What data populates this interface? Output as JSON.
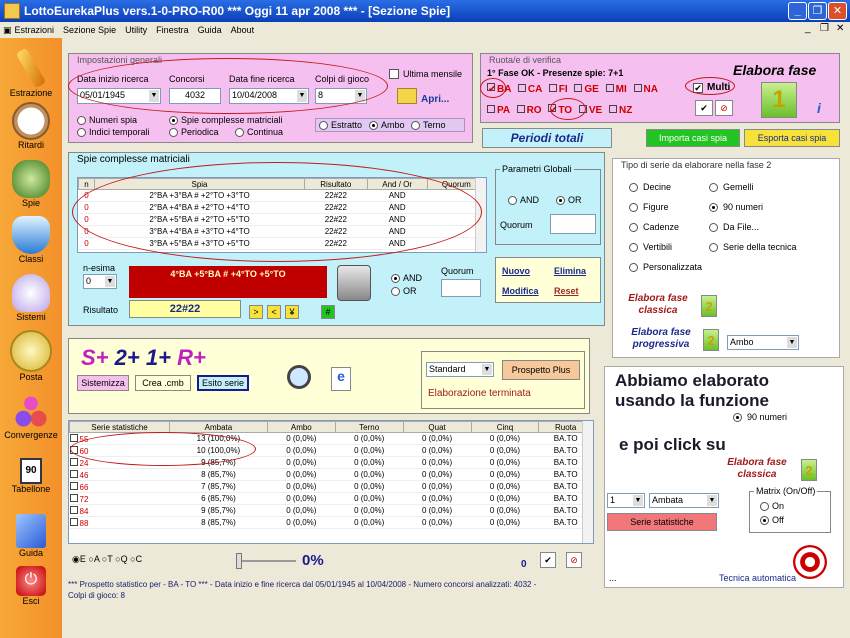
{
  "window": {
    "title": "LottoEurekaPlus vers.1-0-PRO-R00  ***  Oggi 11 apr 2008  ***   - [Sezione Spie]"
  },
  "menu": [
    "Estrazioni",
    "Sezione Spie",
    "Utility",
    "Finestra",
    "Guida",
    "About"
  ],
  "sidebar": [
    "Estrazione",
    "Ritardi",
    "Spie",
    "Classi",
    "Sistemi",
    "Posta",
    "Convergenze",
    "Tabellone",
    "Guida",
    "Esci"
  ],
  "tabellone_num": "90",
  "settings": {
    "title": "Impostazioni generali",
    "date_start_label": "Data inizio ricerca",
    "date_start": "05/01/1945",
    "concorsi_label": "Concorsi",
    "concorsi": "4032",
    "date_end_label": "Data fine ricerca",
    "date_end": "10/04/2008",
    "colpi_label": "Colpi di gioco",
    "colpi": "8",
    "ultima_label": "Ultima mensile",
    "apri_label": "Apri...",
    "numeri_spia": "Numeri spia",
    "spie_complesse": "Spie complesse matriciali",
    "indici": "Indici temporali",
    "periodica": "Periodica",
    "continua": "Continua",
    "estratto": "Estratto",
    "ambo": "Ambo",
    "terno": "Terno"
  },
  "ruota": {
    "title": "Ruota/e di verifica",
    "status": "1° Fase OK - Presenze spie: 7+1",
    "row1": [
      "BA",
      "CA",
      "FI",
      "GE",
      "MI",
      "NA"
    ],
    "row2": [
      "PA",
      "RO",
      "TO",
      "VE",
      "NZ"
    ],
    "multi": "Multi",
    "elabora_fase": "Elabora fase",
    "fase_num": "1"
  },
  "periodi": "Periodi totali",
  "importa": "Importa casi spia",
  "esporta": "Esporta casi spia",
  "spie": {
    "title": "Spie complesse matriciali",
    "headers": [
      "n",
      "Spia",
      "Risultato",
      "And / Or",
      "Quorum"
    ],
    "rows": [
      [
        "0",
        "2°BA +3°BA # +2°TO +3°TO",
        "22#22",
        "AND"
      ],
      [
        "0",
        "2°BA +4°BA # +2°TO +4°TO",
        "22#22",
        "AND"
      ],
      [
        "0",
        "2°BA +5°BA # +2°TO +5°TO",
        "22#22",
        "AND"
      ],
      [
        "0",
        "3°BA +4°BA # +3°TO +4°TO",
        "22#22",
        "AND"
      ],
      [
        "0",
        "3°BA +5°BA # +3°TO +5°TO",
        "22#22",
        "AND"
      ]
    ],
    "nesima_label": "n-esima",
    "nesima": "0",
    "current": "4°BA +5°BA # +4°TO +5°TO",
    "risultato_label": "Risultato",
    "risultato": "22#22",
    "nav": [
      ">",
      "<",
      "¥",
      "#"
    ],
    "and": "AND",
    "or": "OR",
    "quorum_label": "Quorum"
  },
  "parametri": {
    "title": "Parametri Globali",
    "and": "AND",
    "or": "OR",
    "quorum": "Quorum"
  },
  "actions": {
    "nuovo": "Nuovo",
    "elimina": "Elimina",
    "modifica": "Modifica",
    "reset": "Reset"
  },
  "tipo": {
    "title": "Tipo di serie da elaborare nella fase 2",
    "opts": [
      [
        "Decine",
        "Gemelli"
      ],
      [
        "Figure",
        "90 numeri"
      ],
      [
        "Cadenze",
        "Da File..."
      ],
      [
        "Vertibili",
        "Serie della tecnica"
      ],
      [
        "Personalizzata",
        ""
      ]
    ],
    "classica": "Elabora fase classica",
    "progressiva": "Elabora fase progressiva",
    "ambo": "Ambo",
    "fase2": "2"
  },
  "splus": {
    "s": "S+",
    "two": "2+",
    "one": "1+",
    "r": "R+",
    "sistemizza": "Sistemizza",
    "crea": "Crea .cmb",
    "esito": "Esito serie"
  },
  "standard": {
    "combo": "Standard",
    "prospetto": "Prospetto Plus",
    "status": "Elaborazione terminata"
  },
  "annot": {
    "line1": "Abbiamo elaborato",
    "line2": "usando la funzione",
    "radio": "90 numeri",
    "line3": "e poi click su",
    "classica": "Elabora fase classica",
    "fase2": "2"
  },
  "serie": {
    "headers": [
      "Serie statistiche",
      "Ambata",
      "Ambo",
      "Terno",
      "Quat",
      "Cinq",
      "Ruota"
    ],
    "rows": [
      [
        "55",
        "13 (100,0%)",
        "0 (0,0%)",
        "0 (0,0%)",
        "0 (0,0%)",
        "0 (0,0%)",
        "BA.TO"
      ],
      [
        "60",
        "10 (100,0%)",
        "0 (0,0%)",
        "0 (0,0%)",
        "0 (0,0%)",
        "0 (0,0%)",
        "BA.TO"
      ],
      [
        "24",
        "9 (85,7%)",
        "0 (0,0%)",
        "0 (0,0%)",
        "0 (0,0%)",
        "0 (0,0%)",
        "BA.TO"
      ],
      [
        "46",
        "8 (85,7%)",
        "0 (0,0%)",
        "0 (0,0%)",
        "0 (0,0%)",
        "0 (0,0%)",
        "BA.TO"
      ],
      [
        "66",
        "7 (85,7%)",
        "0 (0,0%)",
        "0 (0,0%)",
        "0 (0,0%)",
        "0 (0,0%)",
        "BA.TO"
      ],
      [
        "72",
        "6 (85,7%)",
        "0 (0,0%)",
        "0 (0,0%)",
        "0 (0,0%)",
        "0 (0,0%)",
        "BA.TO"
      ],
      [
        "84",
        "9 (85,7%)",
        "0 (0,0%)",
        "0 (0,0%)",
        "0 (0,0%)",
        "0 (0,0%)",
        "BA.TO"
      ],
      [
        "88",
        "8 (85,7%)",
        "0 (0,0%)",
        "0 (0,0%)",
        "0 (0,0%)",
        "0 (0,0%)",
        "BA.TO"
      ]
    ]
  },
  "bottom": {
    "radios": [
      "E",
      "A",
      "T",
      "Q",
      "C"
    ],
    "pct": "0%",
    "zero": "0"
  },
  "prospetto_text": "*** Prospetto statistico per  - BA - TO ***  - Data inizio e fine ricerca dal 05/01/1945 al 10/04/2008 - Numero concorsi analizzati: 4032 -",
  "colpi_text": "Colpi di gioco: 8",
  "matrix": {
    "colpo": "1",
    "ambata": "Ambata",
    "serie_btn": "Serie statistiche",
    "title": "Matrix (On/Off)",
    "on": "On",
    "off": "Off",
    "tecnica": "Tecnica automatica",
    "dots": "..."
  }
}
